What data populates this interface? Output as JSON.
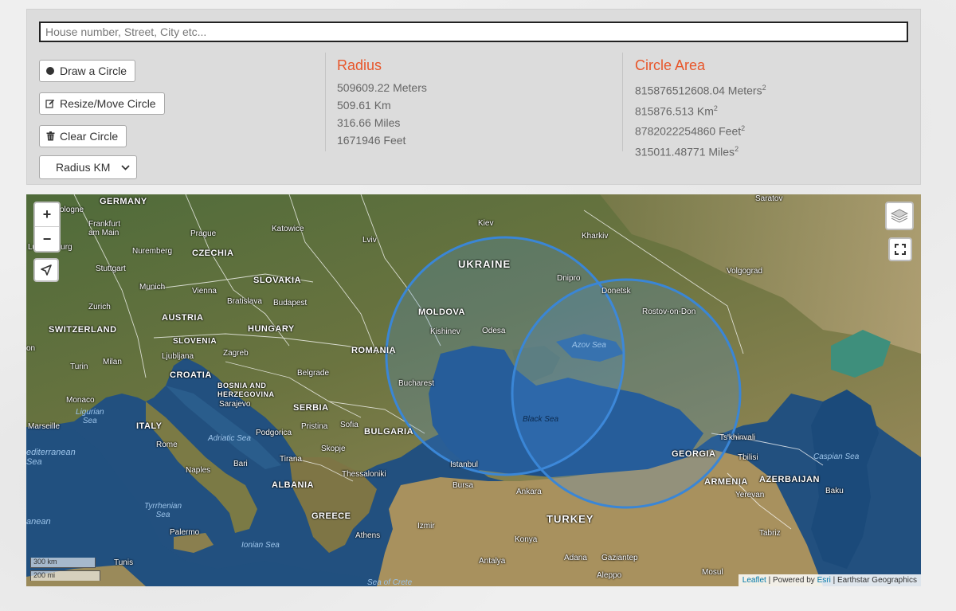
{
  "search": {
    "placeholder": "House number, Street, City etc..."
  },
  "buttons": {
    "draw": "Draw a Circle",
    "resize": "Resize/Move Circle",
    "clear": "Clear Circle"
  },
  "unit_select": {
    "selected": "Radius KM"
  },
  "radius": {
    "title": "Radius",
    "meters": "509609.22 Meters",
    "km": "509.61 Km",
    "miles": "316.66 Miles",
    "feet": "1671946 Feet"
  },
  "area": {
    "title": "Circle Area",
    "meters": "815876512608.04 Meters",
    "km": "815876.513 Km",
    "feet": "8782022254860 Feet",
    "miles": "315011.48771 Miles",
    "sup": "2"
  },
  "map": {
    "zoom_in": "+",
    "zoom_out": "−",
    "scale_km": "300 km",
    "scale_mi": "200 mi",
    "attribution": {
      "leaflet": "Leaflet",
      "sep1": " | Powered by ",
      "esri": "Esri",
      "sep2": " | Earthstar Geographics"
    },
    "labels": {
      "germany": "GERMANY",
      "cologne": "ologne",
      "frankfurt": "Frankfurt\nam Main",
      "luxembourg": "Luxembourg",
      "stuttgart": "Stuttgart",
      "nuremberg": "Nuremberg",
      "munich": "Munich",
      "zurich": "Zurich",
      "switzerland": "SWITZERLAND",
      "turin": "Turin",
      "milan": "Milan",
      "monaco": "Monaco",
      "marseille": "Marseille",
      "ligurian_sea": "Ligurian\nSea",
      "mediterranean": "editerranean\nSea",
      "prague": "Prague",
      "czechia": "CZECHIA",
      "katowice": "Katowice",
      "slovakia": "SLOVAKIA",
      "vienna": "Vienna",
      "bratislava": "Bratislava",
      "budapest": "Budapest",
      "austria": "AUSTRIA",
      "hungary": "HUNGARY",
      "slovenia": "SLOVENIA",
      "ljubljana": "Ljubljana",
      "zagreb": "Zagreb",
      "croatia": "CROATIA",
      "bosnia": "BOSNIA AND\nHERZEGOVINA",
      "sarajevo": "Sarajevo",
      "belgrade": "Belgrade",
      "serbia": "SERBIA",
      "italy": "ITALY",
      "rome": "Rome",
      "adriatic": "Adriatic Sea",
      "podgorica": "Podgorica",
      "pristina": "Pristina",
      "sofia": "Sofia",
      "skopje": "Skopje",
      "tirana": "Tirana",
      "albania": "ALBANIA",
      "bari": "Bari",
      "naples": "Naples",
      "tyrrhenian": "Tyrrhenian\nSea",
      "thessaloniki": "Thessaloniki",
      "greece": "GREECE",
      "palermo": "Palermo",
      "ionian": "Ionian Sea",
      "athens": "Athens",
      "tunis": "Tunis",
      "anean": "anean",
      "lviv": "Lviv",
      "kiev": "Kiev",
      "ukraine": "UKRAINE",
      "kharkiv": "Kharkiv",
      "dnipro": "Dnipro",
      "donetsk": "Donetsk",
      "moldova": "MOLDOVA",
      "kishinev": "Kishinev",
      "odesa": "Odesa",
      "romania": "ROMANIA",
      "bucharest": "Bucharest",
      "bulgaria": "BULGARIA",
      "istanbul": "Istanbul",
      "bursa": "Bursa",
      "izmir": "Izmir",
      "sea_of_crete": "Sea of Crete",
      "black_sea": "Black Sea",
      "azov_sea": "Azov Sea",
      "rostov": "Rostov-on-Don",
      "volgograd": "Volgograd",
      "saratov": "Saratov",
      "ankara": "Ankara",
      "turkey": "TURKEY",
      "konya": "Konya",
      "antalya": "Antalya",
      "adana": "Adana",
      "gaziantep": "Gaziantep",
      "aleppo": "Aleppo",
      "mosul": "Mosul",
      "georgia": "GEORGIA",
      "tskhinvali": "Ts'khinvali",
      "tbilisi": "Tbilisi",
      "armenia": "ARMENIA",
      "yerevan": "Yerevan",
      "azerbaijan": "AZERBAIJAN",
      "baku": "Baku",
      "tabriz": "Tabriz",
      "caspian": "Caspian Sea",
      "on_left": "on"
    }
  },
  "colors": {
    "accent": "#e8562a",
    "circle_stroke": "#3a86d6",
    "circle_fill": "#4a90e2"
  }
}
